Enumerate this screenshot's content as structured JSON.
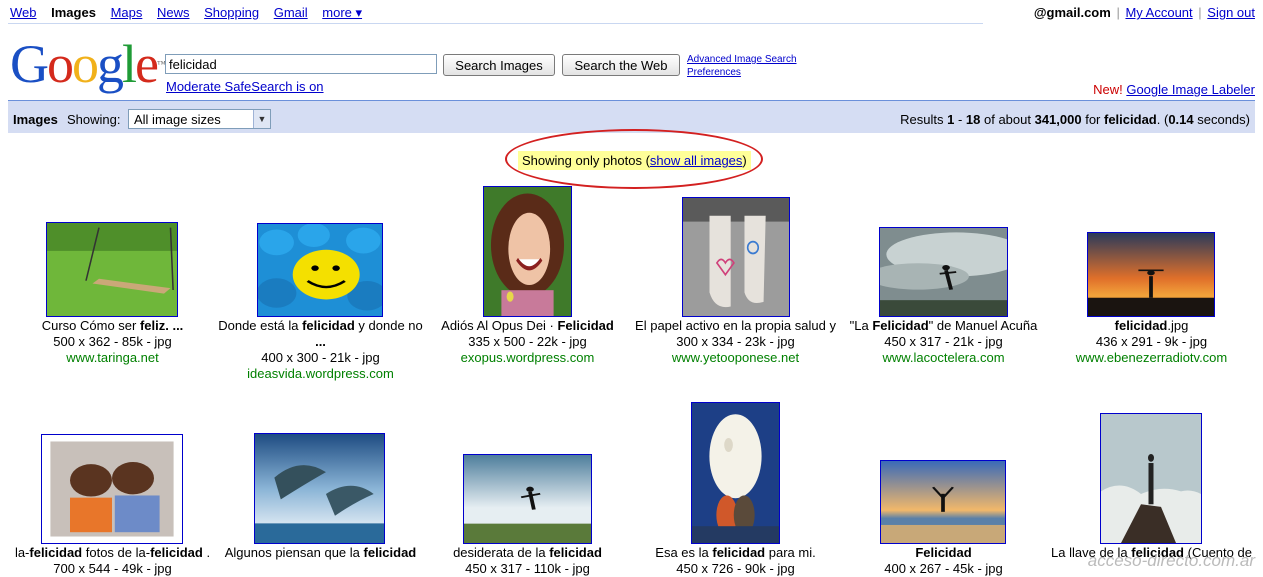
{
  "nav": {
    "items": [
      "Web",
      "Images",
      "Maps",
      "News",
      "Shopping",
      "Gmail",
      "more ▾"
    ],
    "active": "Images"
  },
  "account": {
    "email": "@gmail.com",
    "my_account": "My Account",
    "sign_out": "Sign out"
  },
  "search": {
    "query": "felicidad",
    "search_images_btn": "Search Images",
    "search_web_btn": "Search the Web",
    "advanced": "Advanced Image Search",
    "preferences": "Preferences",
    "safesearch": "Moderate SafeSearch is on"
  },
  "labeler": {
    "new": "New!",
    "link": "Google Image Labeler"
  },
  "bar": {
    "title": "Images",
    "showing": "Showing:",
    "size_selected": "All image sizes",
    "results_prefix": "Results ",
    "from": "1",
    "to": "18",
    "of_about": " of about ",
    "total": "341,000",
    "for": " for ",
    "term": "felicidad",
    "time_prefix": ". (",
    "time": "0.14",
    "time_suffix": " seconds)"
  },
  "notice": {
    "text": "Showing only photos (",
    "link": "show all images",
    "end": ")"
  },
  "results": [
    {
      "cap_pre": "Curso Cómo ser ",
      "cap_bold": "feliz. ...",
      "cap_post": "",
      "meta": "500 x 362 - 85k - jpg",
      "url": "www.taringa.net",
      "scene": "swing"
    },
    {
      "cap_pre": "Donde está la ",
      "cap_bold": "felicidad",
      "cap_post": " y donde no",
      "cap2": "...",
      "meta": "400 x 300 - 21k - jpg",
      "url": "ideasvida.wordpress.com",
      "scene": "smiley"
    },
    {
      "cap_pre": "Adiós Al Opus Dei · ",
      "cap_bold": "Felicidad",
      "cap_post": "",
      "meta": "335 x 500 - 22k - jpg",
      "url": "exopus.wordpress.com",
      "scene": "girl"
    },
    {
      "cap_pre": "El papel activo en la propia salud y",
      "cap_bold": "",
      "cap_post": "",
      "meta": "300 x 334 - 23k - jpg",
      "url": "www.yetooponese.net",
      "scene": "feet"
    },
    {
      "cap_pre": "\"La ",
      "cap_bold": "Felicidad",
      "cap_post": "\" de Manuel Acuña",
      "meta": "450 x 317 - 21k - jpg",
      "url": "www.lacoctelera.com",
      "scene": "jumpsky"
    },
    {
      "cap_pre": "",
      "cap_bold": "felicidad",
      "cap_post": ".jpg",
      "meta": "436 x 291 - 9k - jpg",
      "url": "www.ebenezerradiotv.com",
      "scene": "sunset"
    },
    {
      "cap_pre": "la-",
      "cap_bold": "felicidad",
      "cap_post": " fotos de la-",
      "cap_bold2": "felicidad",
      "cap_post2": " .",
      "meta": "700 x 544 - 49k - jpg",
      "url": "",
      "scene": "kids"
    },
    {
      "cap_pre": "Algunos piensan que la ",
      "cap_bold": "felicidad",
      "cap_post": "",
      "meta": "",
      "url": "",
      "scene": "dolphins"
    },
    {
      "cap_pre": "desiderata de la ",
      "cap_bold": "felicidad",
      "cap_post": "",
      "meta": "450 x 317 - 110k - jpg",
      "url": "",
      "scene": "jumpgrass"
    },
    {
      "cap_pre": "Esa es la ",
      "cap_bold": "felicidad",
      "cap_post": " para mi.",
      "meta": "450 x 726 - 90k - jpg",
      "url": "",
      "scene": "moon"
    },
    {
      "cap_pre": "",
      "cap_bold": "Felicidad",
      "cap_post": "",
      "meta": "400 x 267 - 45k - jpg",
      "url": "",
      "scene": "beach"
    },
    {
      "cap_pre": "La llave de la ",
      "cap_bold": "felicidad",
      "cap_post": " (Cuento de",
      "meta": "",
      "url": "",
      "scene": "wanderer"
    }
  ],
  "watermark": "acceso-directo.com.ar"
}
